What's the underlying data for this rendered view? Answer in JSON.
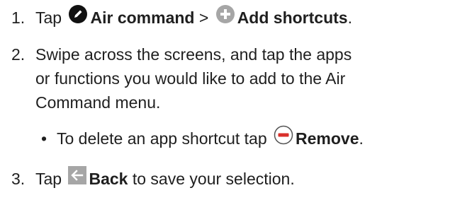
{
  "steps": [
    {
      "number": "1.",
      "prefix": "Tap",
      "item1": "Air command",
      "sep": ">",
      "item2": "Add shortcuts",
      "suffix": "."
    },
    {
      "number": "2.",
      "line1": "Swipe across the screens, and tap the apps",
      "line2": "or functions you would like to add to the Air",
      "line3": "Command menu."
    },
    {
      "number": "3.",
      "prefix": "Tap",
      "item": "Back",
      "rest": "to save your selection."
    }
  ],
  "bullet": {
    "marker": "•",
    "text": "To delete an app shortcut tap",
    "item": "Remove",
    "suffix": "."
  },
  "icons": {
    "air_command": "pen-circle-icon",
    "add_shortcuts": "plus-circle-icon",
    "remove": "minus-circle-icon",
    "back": "back-arrow-icon"
  },
  "colors": {
    "text": "#1f1f1f",
    "icon_dark": "#111111",
    "icon_gray": "#a6a6a6",
    "remove_red": "#d9302b"
  }
}
